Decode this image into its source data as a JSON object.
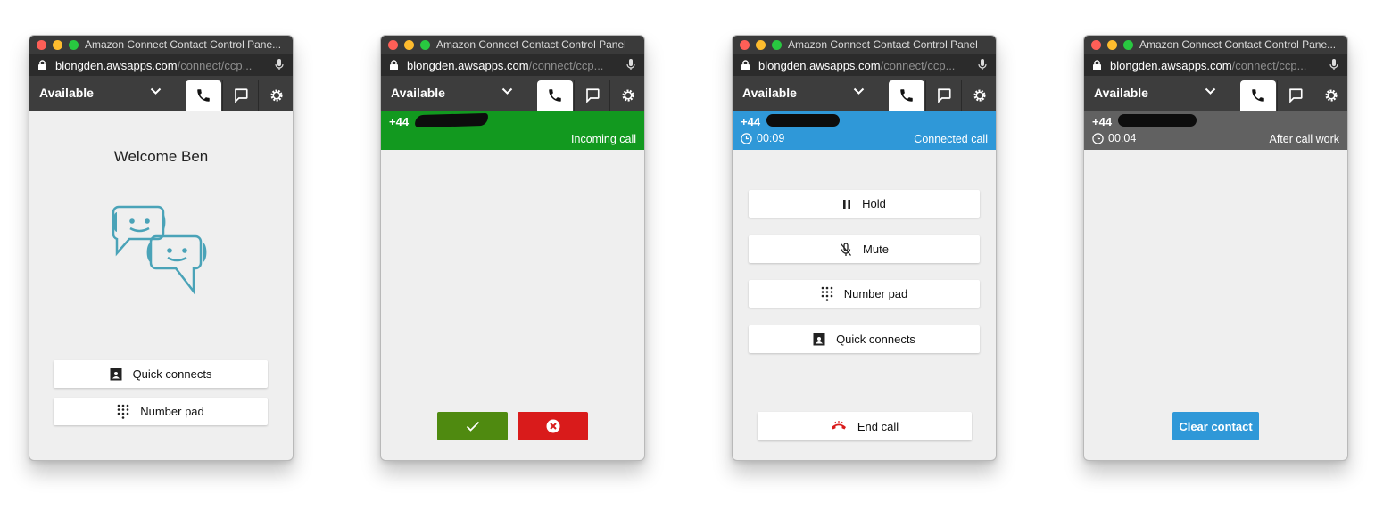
{
  "window_title": "Amazon Connect Contact Control Panel",
  "url_host": "blongden.awsapps.com",
  "url_path": "/connect/ccp...",
  "agent_status": "Available",
  "panels": [
    {
      "title": "Amazon Connect Contact Control Pane...",
      "welcome": "Welcome Ben",
      "buttons": {
        "quick_connects": "Quick connects",
        "number_pad": "Number pad"
      }
    },
    {
      "title": "Amazon Connect Contact Control Panel",
      "caller_prefix": "+44",
      "banner_status": "Incoming call",
      "banner_color": "#12991f",
      "accept_color": "#4f8a10",
      "reject_color": "#d91b1b"
    },
    {
      "title": "Amazon Connect Contact Control Panel",
      "caller_prefix": "+44",
      "timer": "00:09",
      "banner_status": "Connected call",
      "banner_color": "#2f98d8",
      "buttons": {
        "hold": "Hold",
        "mute": "Mute",
        "number_pad": "Number pad",
        "quick_connects": "Quick connects",
        "end_call": "End call"
      }
    },
    {
      "title": "Amazon Connect Contact Control Pane...",
      "caller_prefix": "+44",
      "timer": "00:04",
      "banner_status": "After call work",
      "banner_color": "#616161",
      "buttons": {
        "clear_contact": "Clear contact"
      }
    }
  ],
  "icons": [
    "lock-icon",
    "microphone-icon",
    "chevron-down-icon",
    "phone-icon",
    "chat-icon",
    "gear-icon",
    "clock-icon",
    "pause-icon",
    "mic-off-icon",
    "keypad-icon",
    "contact-card-icon",
    "check-icon",
    "close-circle-icon",
    "hang-up-icon",
    "chat-bots-illustration"
  ]
}
